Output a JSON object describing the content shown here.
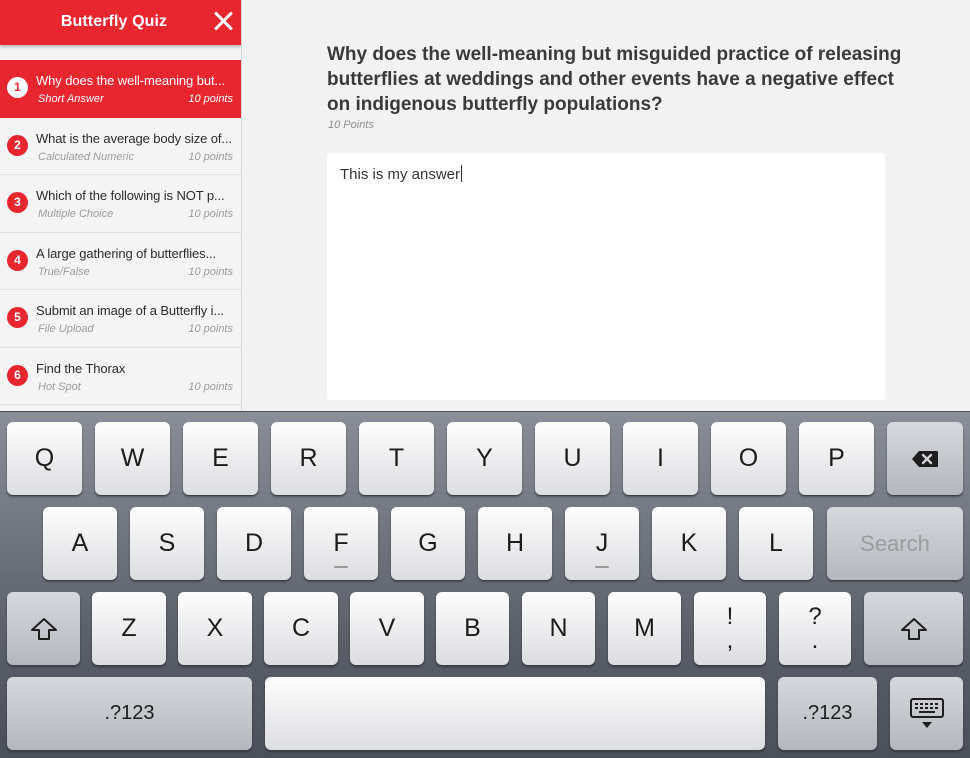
{
  "sidebar": {
    "title": "Butterfly Quiz",
    "items": [
      {
        "num": "1",
        "title": "Why does the well-meaning but...",
        "type": "Short Answer",
        "points": "10 points",
        "active": true
      },
      {
        "num": "2",
        "title": "What is the average body size of...",
        "type": "Calculated Numeric",
        "points": "10 points"
      },
      {
        "num": "3",
        "title": "Which of the following is NOT p...",
        "type": "Multiple Choice",
        "points": "10 points"
      },
      {
        "num": "4",
        "title": "A large gathering of butterflies...",
        "type": "True/False",
        "points": "10 points"
      },
      {
        "num": "5",
        "title": "Submit an image of a Butterfly i...",
        "type": "File Upload",
        "points": "10 points"
      },
      {
        "num": "6",
        "title": "Find the Thorax",
        "type": "Hot Spot",
        "points": "10 points"
      }
    ]
  },
  "main": {
    "question": "Why does the well-meaning but misguided practice of releasing butterflies at weddings and other events have a negative effect on indigenous butterfly populations?",
    "points": "10 Points",
    "answer": "This is my answer"
  },
  "keyboard": {
    "row1": [
      "Q",
      "W",
      "E",
      "R",
      "T",
      "Y",
      "U",
      "I",
      "O",
      "P"
    ],
    "row2": [
      "A",
      "S",
      "D",
      "F",
      "G",
      "H",
      "J",
      "K",
      "L"
    ],
    "row3": [
      "Z",
      "X",
      "C",
      "V",
      "B",
      "N",
      "M"
    ],
    "punct1": {
      "top": "!",
      "bottom": ","
    },
    "punct2": {
      "top": "?",
      "bottom": "."
    },
    "search_label": "Search",
    "numbers_label": ".?123",
    "icons": {
      "backspace": "backspace-icon",
      "shift": "shift-icon",
      "dismiss": "keyboard-dismiss-icon"
    },
    "accent": "#e8262f"
  }
}
